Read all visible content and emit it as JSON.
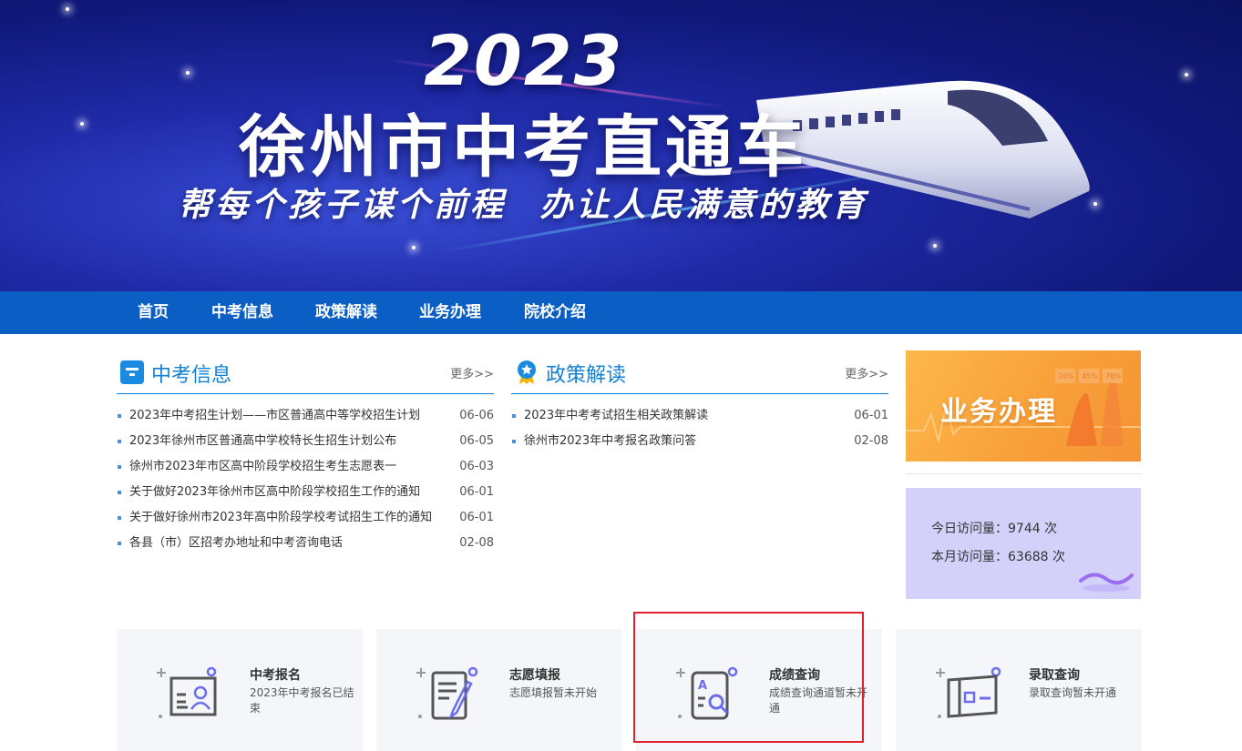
{
  "banner": {
    "year": "2023",
    "title": "徐州市中考直通车",
    "slogan": "帮每个孩子谋个前程 办让人民满意的教育"
  },
  "nav": {
    "items": [
      "首页",
      "中考信息",
      "政策解读",
      "业务办理",
      "院校介绍"
    ]
  },
  "info": {
    "title": "中考信息",
    "more": "更多>>",
    "items": [
      {
        "title": "2023年中考招生计划——市区普通高中等学校招生计划",
        "date": "06-06"
      },
      {
        "title": "2023年徐州市区普通高中学校特长生招生计划公布",
        "date": "06-05"
      },
      {
        "title": "徐州市2023年市区高中阶段学校招生考生志愿表一",
        "date": "06-03"
      },
      {
        "title": "关于做好2023年徐州市区高中阶段学校招生工作的通知",
        "date": "06-01"
      },
      {
        "title": "关于做好徐州市2023年高中阶段学校考试招生工作的通知",
        "date": "06-01"
      },
      {
        "title": "各县（市）区招考办地址和中考咨询电话",
        "date": "02-08"
      }
    ]
  },
  "policy": {
    "title": "政策解读",
    "more": "更多>>",
    "items": [
      {
        "title": "2023年中考考试招生相关政策解读",
        "date": "06-01"
      },
      {
        "title": "徐州市2023年中考报名政策问答",
        "date": "02-08"
      }
    ]
  },
  "sidebar": {
    "business_label": "业务办理",
    "chart_badges": [
      "20%",
      "45%",
      "76%"
    ],
    "today_label": "今日访问量：",
    "today_value": "9744",
    "month_label": "本月访问量：",
    "month_value": "63688",
    "unit": "次"
  },
  "cards": [
    {
      "title": "中考报名",
      "desc": "2023年中考报名已结束",
      "icon": "registration-form-icon"
    },
    {
      "title": "志愿填报",
      "desc": "志愿填报暂未开始",
      "icon": "form-pen-icon"
    },
    {
      "title": "成绩查询",
      "desc": "成绩查询通道暂未开通",
      "icon": "score-search-icon"
    },
    {
      "title": "录取查询",
      "desc": "录取查询暂未开通",
      "icon": "admission-card-icon"
    }
  ],
  "colors": {
    "nav_bg": "#0b5fc4",
    "accent_blue": "#1380d6",
    "business_orange": "#f8a03a",
    "stats_bg": "#d3d1fa",
    "highlight_red": "#e0202a"
  }
}
